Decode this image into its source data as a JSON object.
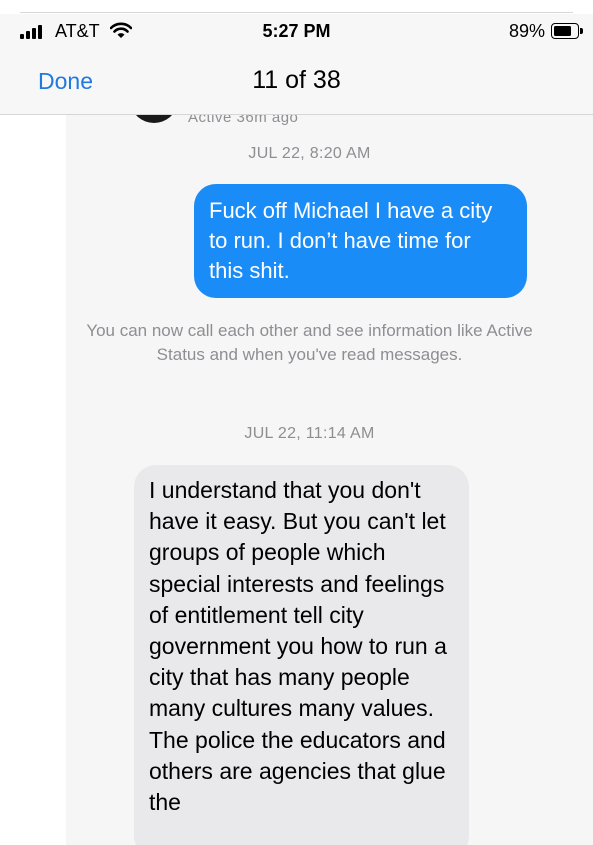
{
  "status_bar": {
    "carrier": "AT&T",
    "time": "5:27 PM",
    "battery_percent": "89%",
    "battery_level": 0.89,
    "icons": [
      "signal-bars-icon",
      "wifi-icon",
      "battery-icon"
    ]
  },
  "nav": {
    "done_label": "Done",
    "title": "11 of 38"
  },
  "conversation": {
    "previous_status": "Active 36m ago",
    "messages": [
      {
        "timestamp": "JUL 22, 8:20 AM",
        "direction": "outgoing",
        "text": "Fuck off Michael I have a city to run. I don’t have time for this shit."
      },
      {
        "system_note": "You can now call each other and see information like Active Status and when you've read messages."
      },
      {
        "timestamp": "JUL 22, 11:14 AM",
        "direction": "incoming",
        "text": "I understand that you don't have it easy. But you can't let groups of people which special interests and feelings of entitlement tell city government you how to run a city that has many people many cultures many values. The police the educators and others are agencies that glue the"
      }
    ]
  },
  "colors": {
    "accent": "#1f7ae0",
    "outgoing_bubble": "#1a8cf7",
    "incoming_bubble": "#e9e9eb",
    "meta_text": "#8e8e93"
  }
}
